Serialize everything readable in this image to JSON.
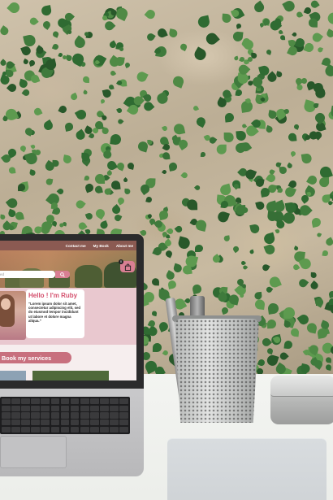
{
  "scene": {
    "wall_color": "#c8baa1",
    "ivy_color": "#3f7a3c",
    "desk_color": "#eceeea"
  },
  "site": {
    "nav": [
      "Contact me",
      "My Book",
      "About me"
    ],
    "search_placeholder": "ed",
    "cart_count": "0",
    "intro": {
      "title": "Hello ! I'm Ruby",
      "body": "“Lorem ipsum dolor sit amet, consectetur adipiscing elit, sed do eiusmod tempor incididunt ut labore et dolore magna aliqua.”"
    },
    "cta_label": "Book my services",
    "accent_color": "#d97f93",
    "brand_color": "#8b5a52"
  }
}
